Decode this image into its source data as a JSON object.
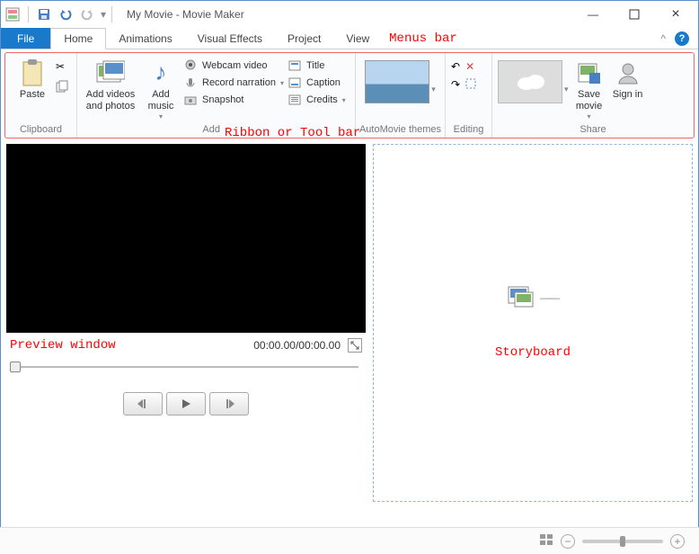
{
  "title": "My Movie - Movie Maker",
  "menus": {
    "file": "File",
    "home": "Home",
    "animations": "Animations",
    "visual_effects": "Visual Effects",
    "project": "Project",
    "view": "View"
  },
  "annotations": {
    "menus": "Menus bar",
    "ribbon": "Ribbon or Tool bar",
    "preview": "Preview window",
    "storyboard": "Storyboard"
  },
  "ribbon": {
    "clipboard": {
      "paste": "Paste",
      "label": "Clipboard"
    },
    "add": {
      "videos": "Add videos and photos",
      "music": "Add music",
      "webcam": "Webcam video",
      "narration": "Record narration",
      "snapshot": "Snapshot",
      "title": "Title",
      "caption": "Caption",
      "credits": "Credits",
      "label": "Add"
    },
    "automovie": {
      "label": "AutoMovie themes"
    },
    "editing": {
      "label": "Editing"
    },
    "share": {
      "save": "Save movie",
      "signin": "Sign in",
      "label": "Share"
    }
  },
  "preview": {
    "time": "00:00.00/00:00.00"
  }
}
